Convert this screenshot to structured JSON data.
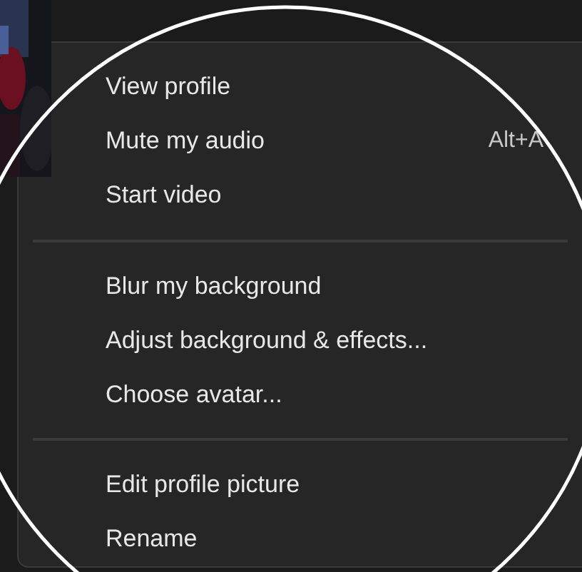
{
  "menu": {
    "groups": [
      {
        "items": [
          {
            "label": "View profile"
          },
          {
            "label": "Mute my audio",
            "shortcut": "Alt+A"
          },
          {
            "label": "Start video"
          }
        ]
      },
      {
        "items": [
          {
            "label": "Blur my background"
          },
          {
            "label": "Adjust background & effects..."
          },
          {
            "label": "Choose avatar..."
          }
        ]
      },
      {
        "items": [
          {
            "label": "Edit profile picture"
          },
          {
            "label": "Rename"
          }
        ]
      }
    ]
  }
}
